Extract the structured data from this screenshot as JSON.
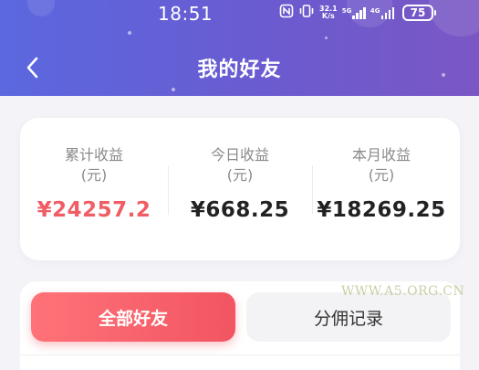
{
  "status_bar": {
    "time": "18:51",
    "speed_value": "32.1",
    "speed_unit": "K/s",
    "net1_label": "5G",
    "net2_label": "4G",
    "battery": "75",
    "icons": [
      "nfc-icon",
      "vibrate-icon",
      "signal-icon",
      "signal-icon",
      "battery-icon"
    ]
  },
  "nav": {
    "back_icon": "chevron-left-icon",
    "title": "我的好友"
  },
  "stats": [
    {
      "label": "累计收益",
      "unit": "(元)",
      "value": "¥24257.2",
      "color": "#f05d64"
    },
    {
      "label": "今日收益",
      "unit": "(元)",
      "value": "¥668.25",
      "color": "#222222"
    },
    {
      "label": "本月收益",
      "unit": "(元)",
      "value": "¥18269.25",
      "color": "#222222"
    }
  ],
  "tabs": [
    {
      "label": "全部好友",
      "active": true
    },
    {
      "label": "分佣记录",
      "active": false
    }
  ],
  "watermark": "WWW.A5.ORG.CN",
  "colors": {
    "header_start": "#5b68df",
    "header_end": "#7a57c4",
    "accent": "#f25562",
    "highlight_value": "#f05d64"
  }
}
